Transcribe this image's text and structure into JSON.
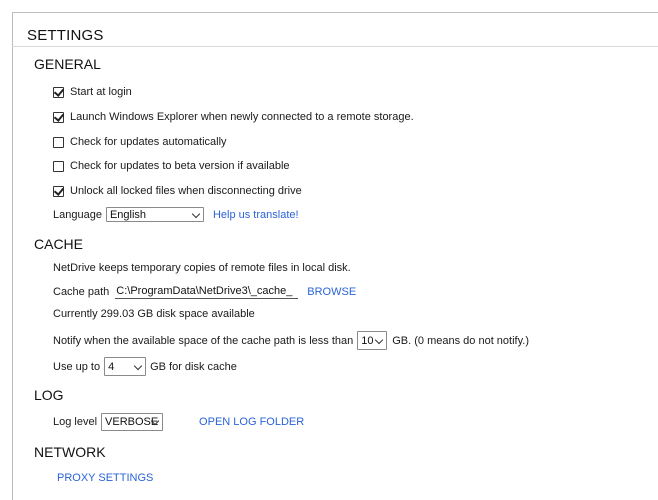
{
  "page": {
    "title": "SETTINGS"
  },
  "general": {
    "heading": "GENERAL",
    "options": [
      {
        "label": "Start at login",
        "checked": true
      },
      {
        "label": "Launch Windows Explorer when newly connected to a remote storage.",
        "checked": true
      },
      {
        "label": "Check for updates automatically",
        "checked": false
      },
      {
        "label": "Check for updates to beta version if available",
        "checked": false
      },
      {
        "label": "Unlock all locked files when disconnecting drive",
        "checked": true
      }
    ],
    "language_label": "Language",
    "language_value": "English",
    "translate_link": "Help us translate!"
  },
  "cache": {
    "heading": "CACHE",
    "description": "NetDrive keeps temporary copies of remote files in local disk.",
    "path_label": "Cache path",
    "path_value": "C:\\ProgramData\\NetDrive3\\_cache_",
    "browse_label": "BROWSE",
    "space_text": "Currently 299.03 GB disk space available",
    "notify_prefix": "Notify when the available space of the cache path is less than",
    "notify_value": "10",
    "notify_suffix": "GB.  (0 means do not notify.)",
    "useup_prefix": "Use up to",
    "useup_value": "4",
    "useup_suffix": "GB for disk cache"
  },
  "log": {
    "heading": "LOG",
    "level_label": "Log level",
    "level_value": "VERBOSE",
    "open_folder_label": "OPEN LOG FOLDER"
  },
  "network": {
    "heading": "NETWORK",
    "proxy_label": "PROXY SETTINGS"
  },
  "colors": {
    "link": "#2a63d8",
    "border": "#bdbdbd"
  }
}
